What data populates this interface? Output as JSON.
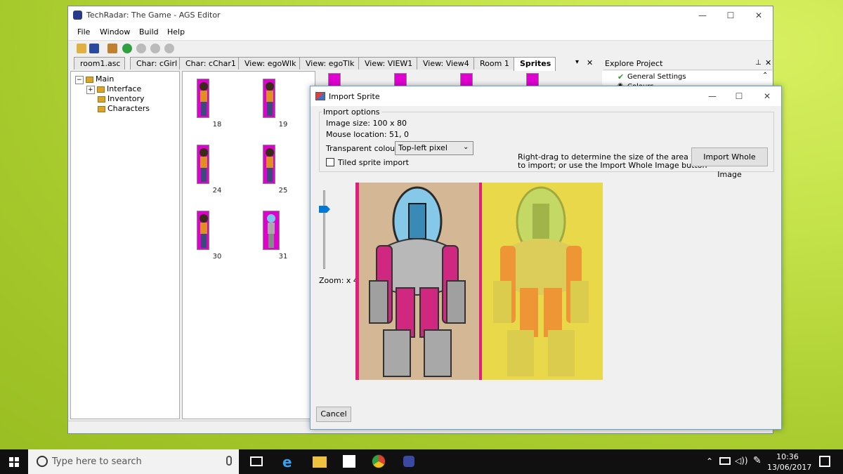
{
  "window": {
    "title": "TechRadar: The Game - AGS Editor",
    "controls": {
      "minimize": "—",
      "maximize": "☐",
      "close": "✕"
    }
  },
  "menu": {
    "items": [
      "File",
      "Window",
      "Build",
      "Help"
    ]
  },
  "tabs": [
    {
      "label": "room1.asc"
    },
    {
      "label": "Char: cGirl"
    },
    {
      "label": "Char: cChar1"
    },
    {
      "label": "View: egoWlk"
    },
    {
      "label": "View: egoTlk"
    },
    {
      "label": "View: VIEW1"
    },
    {
      "label": "View: View4"
    },
    {
      "label": "Room 1"
    },
    {
      "label": "Sprites",
      "active": true
    }
  ],
  "tree": {
    "root": "Main",
    "children": [
      "Interface",
      "Inventory",
      "Characters"
    ]
  },
  "sprites": {
    "numbers": [
      "18",
      "19",
      "24",
      "25",
      "30",
      "31"
    ]
  },
  "explore": {
    "title": "Explore Project",
    "items": [
      "General Settings",
      "Colours"
    ]
  },
  "dialog": {
    "title": "Import Sprite",
    "group_label": "Import options",
    "image_size": "Image size: 100 x 80",
    "mouse_location": "Mouse location: 51, 0",
    "transparent_label": "Transparent colour:",
    "transparent_value": "Top-left pixel",
    "tiled_label": "Tiled sprite import",
    "hint_line1": "Right-drag to determine the size of the area you wish",
    "hint_line2": "to import; or use the Import Whole Image button",
    "import_whole_label": "Import Whole Image",
    "zoom_label": "Zoom: x 4",
    "cancel_label": "Cancel"
  },
  "taskbar": {
    "search_placeholder": "Type here to search",
    "time": "10:36",
    "date": "13/06/2017"
  },
  "colors": {
    "accent": "#0078d7",
    "sprite_magenta": "#e000d0",
    "preview_left_bg": "#d4b896",
    "preview_right_bg": "#e8d84a"
  }
}
